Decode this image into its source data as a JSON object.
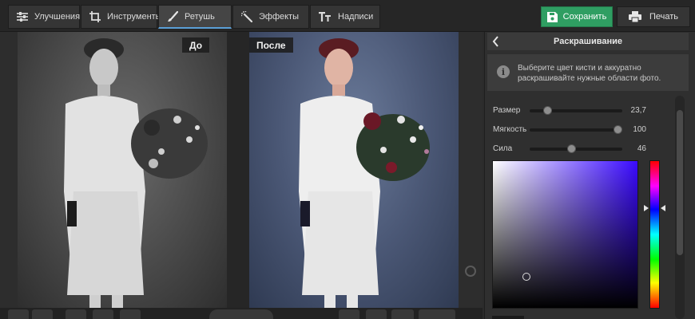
{
  "toolbar": {
    "tabs": [
      {
        "label": "Улучшения",
        "icon": "sliders-icon"
      },
      {
        "label": "Инструменты",
        "icon": "crop-icon"
      },
      {
        "label": "Ретушь",
        "icon": "brush-icon",
        "active": true
      },
      {
        "label": "Эффекты",
        "icon": "magic-wand-icon"
      },
      {
        "label": "Надписи",
        "icon": "text-icon"
      }
    ],
    "save_label": "Сохранить",
    "print_label": "Печать"
  },
  "photos": {
    "before_label": "До",
    "after_label": "После"
  },
  "panel": {
    "title": "Раскрашивание",
    "hint": "Выберите цвет кисти и аккуратно раскрашивайте нужные области фото.",
    "params": [
      {
        "label": "Размер",
        "value": "23,7",
        "level": 0.19
      },
      {
        "label": "Мягкость",
        "value": "100",
        "level": 0.95
      },
      {
        "label": "Сила",
        "value": "46",
        "level": 0.45
      }
    ],
    "color_picker": {
      "saturation": 0.23,
      "brightness": 0.22,
      "hue_position": 0.32
    }
  },
  "colors": {
    "save_button": "#2f9e62",
    "active_tab_underline": "#5a9fd6",
    "toolbar_bg": "#262626",
    "panel_bg": "#2f2f2f"
  }
}
